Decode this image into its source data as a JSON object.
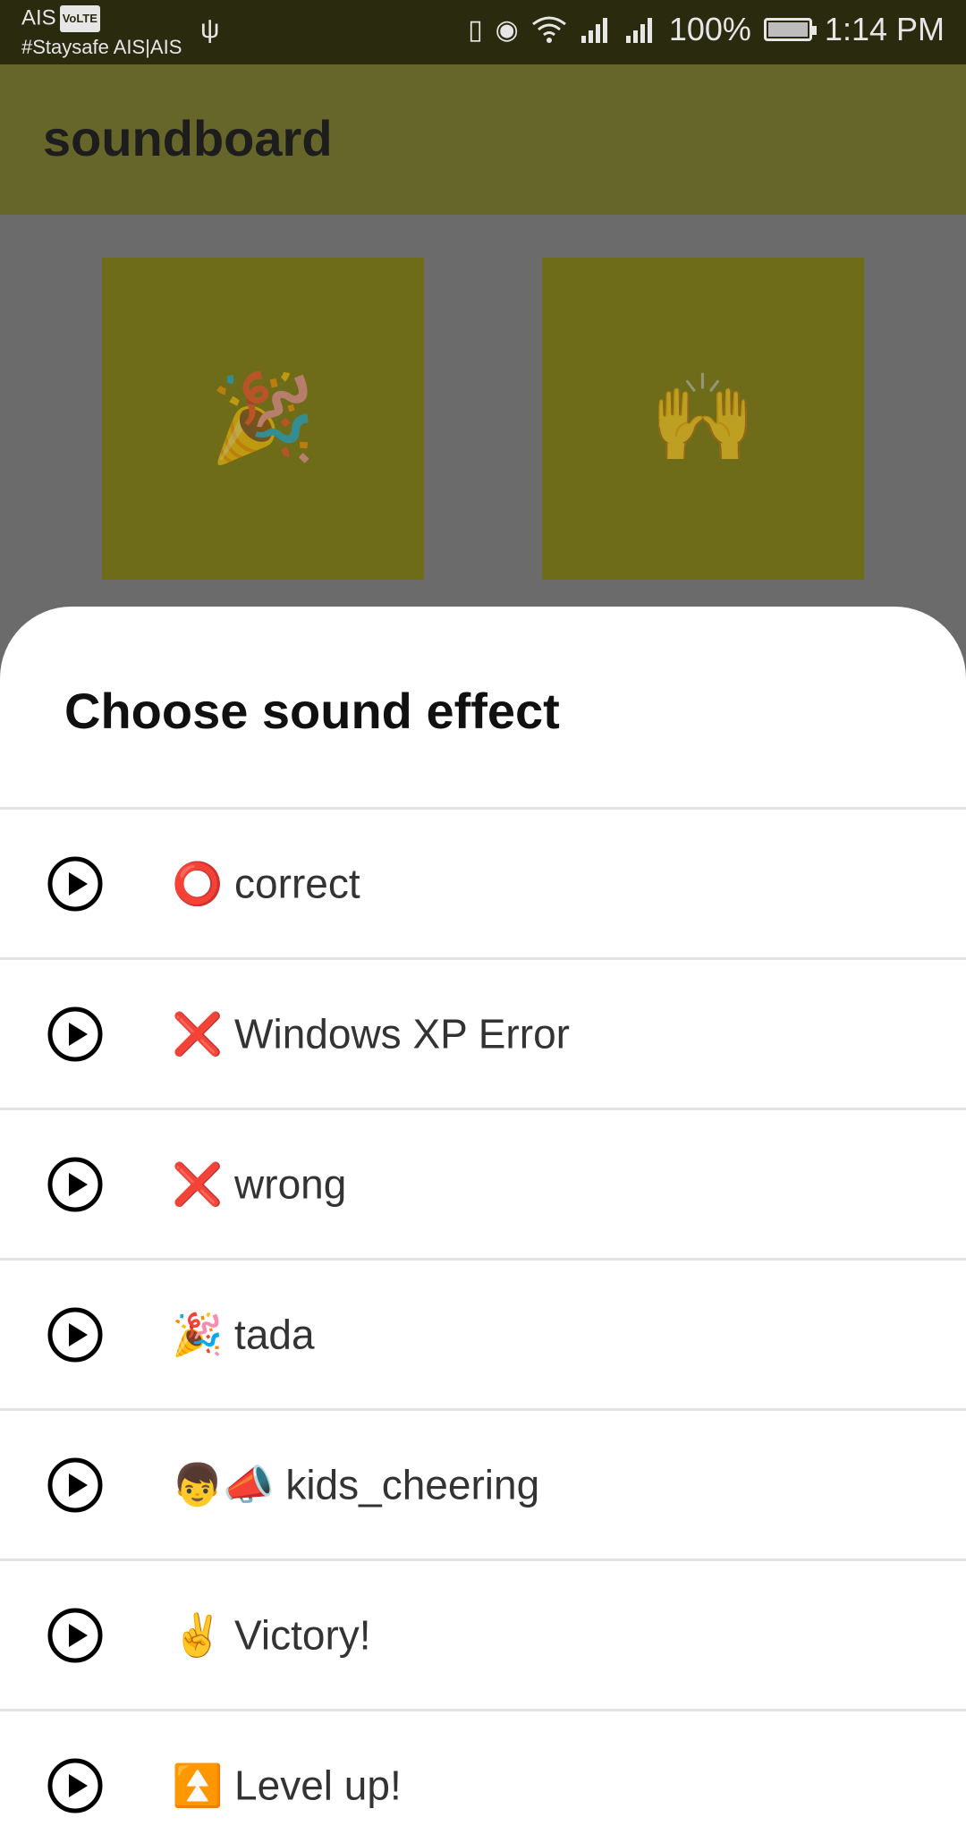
{
  "status_bar": {
    "carrier": "AIS",
    "volte": "VoLTE",
    "carrier_sub": "#Staysafe AIS|AIS",
    "battery": "100%",
    "battery_level": 1.0,
    "time": "1:14 PM",
    "icons": [
      "usb-icon",
      "vibrate-icon",
      "eye-icon",
      "wifi-icon",
      "signal-icon",
      "signal-icon",
      "battery-charging-icon"
    ]
  },
  "app_bar": {
    "title": "soundboard"
  },
  "tiles": [
    {
      "emoji": "🎉",
      "icon": "party-popper-icon"
    },
    {
      "emoji": "🙌",
      "icon": "raising-hands-icon"
    }
  ],
  "sheet": {
    "title": "Choose sound effect",
    "items": [
      {
        "label": "⭕ correct"
      },
      {
        "label": "❌ Windows XP Error"
      },
      {
        "label": "❌ wrong"
      },
      {
        "label": "🎉 tada"
      },
      {
        "label": "👦📣 kids_cheering"
      },
      {
        "label": "✌️ Victory!"
      },
      {
        "label": "⏫ Level up!"
      }
    ]
  },
  "colors": {
    "status_bar_bg": "#2a2a0f",
    "app_bar_bg": "#66652a",
    "tile_bg": "#6e6b19",
    "scrim": "#6b6b6b",
    "sheet_bg": "#ffffff"
  }
}
